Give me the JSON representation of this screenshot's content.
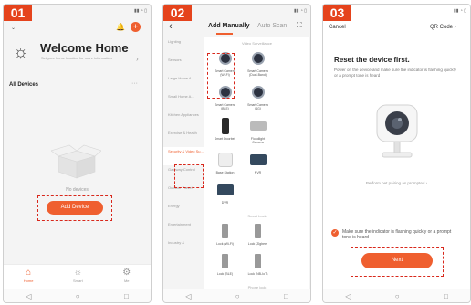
{
  "colors": {
    "accent": "#ef5f2f",
    "highlight": "#d8281c"
  },
  "steps": [
    "01",
    "02",
    "03"
  ],
  "screen1": {
    "home_label": "",
    "welcome": "Welcome Home",
    "welcome_sub": "Set your home location for more information",
    "section": "All Devices",
    "empty_text": "No devices",
    "add_button": "Add Device",
    "tabs": [
      {
        "label": "Home",
        "icon": "home-icon",
        "active": true
      },
      {
        "label": "Smart",
        "icon": "smart-icon",
        "active": false
      },
      {
        "label": "Me",
        "icon": "me-icon",
        "active": false
      }
    ]
  },
  "screen2": {
    "tab_manual": "Add Manually",
    "tab_auto": "Auto Scan",
    "categories": [
      "Lighting",
      "Sensors",
      "Large Home A...",
      "Small Home A...",
      "Kitchen Appliances",
      "Exercise & Health",
      "Security & Video Su...",
      "Gateway Control",
      "Outdoor Travel",
      "Energy",
      "Entertainment",
      "Industry &"
    ],
    "selected_category": "Security & Video Su...",
    "section_video": "Video Surveillance",
    "devices_video": [
      {
        "label": "Smart Camera (Wi-Fi)",
        "kind": "cam"
      },
      {
        "label": "Smart Camera (Dual-Band)",
        "kind": "cam"
      },
      {
        "label": "Smart Camera (BLE)",
        "kind": "cam"
      },
      {
        "label": "Smart Camera (4G)",
        "kind": "cam"
      },
      {
        "label": "Smart Doorbell",
        "kind": "bell"
      },
      {
        "label": "Floodlight Camera",
        "kind": "flood"
      },
      {
        "label": "Base Station",
        "kind": "base"
      },
      {
        "label": "NVR",
        "kind": "nvr"
      },
      {
        "label": "DVR",
        "kind": "nvr"
      }
    ],
    "section_lock": "Smart Lock",
    "devices_lock": [
      {
        "label": "Lock (Wi-Fi)",
        "kind": "lock"
      },
      {
        "label": "Lock (Zigbee)",
        "kind": "lock"
      },
      {
        "label": "Lock (BLE)",
        "kind": "lock"
      },
      {
        "label": "Lock (NB-IoT)",
        "kind": "lock"
      }
    ],
    "section_last": "Phone lock"
  },
  "screen3": {
    "cancel": "Cancel",
    "qr_code": "QR Code ›",
    "title": "Reset the device first.",
    "desc": "Power on the device and make sure the indicator is flashing quickly or a prompt tone is heard",
    "perform": "Perform net pairing as prompted ›",
    "confirm": "Make sure the indicator is flashing quickly or a prompt tone is heard",
    "next": "Next"
  }
}
